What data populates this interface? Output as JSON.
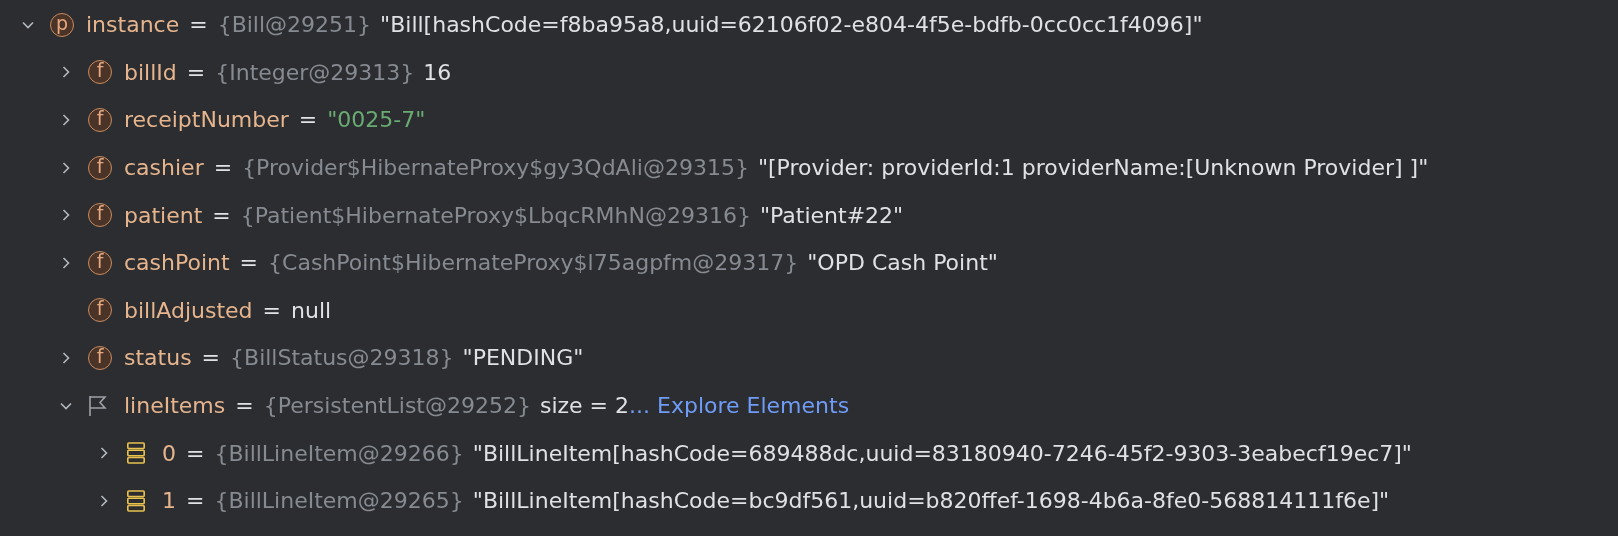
{
  "tree": [
    {
      "name": "instance",
      "icon": {
        "kind": "letter",
        "glyph": "p"
      },
      "expandable": true,
      "expanded": true,
      "eq": "=",
      "type": "{Bill@29251}",
      "value": "\"Bill[hashCode=f8ba95a8,uuid=62106f02-e804-4f5e-bdfb-0cc0cc1f4096]\"",
      "string": false,
      "children": [
        {
          "name": "billId",
          "icon": {
            "kind": "letter",
            "glyph": "f"
          },
          "expandable": true,
          "expanded": false,
          "eq": "=",
          "type": "{Integer@29313}",
          "value": "16",
          "string": false
        },
        {
          "name": "receiptNumber",
          "icon": {
            "kind": "letter",
            "glyph": "f"
          },
          "expandable": true,
          "expanded": false,
          "eq": "=",
          "value": "\"0025-7\"",
          "string": true
        },
        {
          "name": "cashier",
          "icon": {
            "kind": "letter",
            "glyph": "f"
          },
          "expandable": true,
          "expanded": false,
          "eq": "=",
          "type": "{Provider$HibernateProxy$gy3QdAli@29315}",
          "value": "\"[Provider: providerId:1 providerName:[Unknown Provider] ]\"",
          "string": false
        },
        {
          "name": "patient",
          "icon": {
            "kind": "letter",
            "glyph": "f"
          },
          "expandable": true,
          "expanded": false,
          "eq": "=",
          "type": "{Patient$HibernateProxy$LbqcRMhN@29316}",
          "value": "\"Patient#22\"",
          "string": false
        },
        {
          "name": "cashPoint",
          "icon": {
            "kind": "letter",
            "glyph": "f"
          },
          "expandable": true,
          "expanded": false,
          "eq": "=",
          "type": "{CashPoint$HibernateProxy$l75agpfm@29317}",
          "value": "\"OPD Cash Point\"",
          "string": false
        },
        {
          "name": "billAdjusted",
          "icon": {
            "kind": "letter",
            "glyph": "f"
          },
          "expandable": false,
          "eq": "=",
          "value": "null",
          "string": false
        },
        {
          "name": "status",
          "icon": {
            "kind": "letter",
            "glyph": "f"
          },
          "expandable": true,
          "expanded": false,
          "eq": "=",
          "type": "{BillStatus@29318}",
          "value": "\"PENDING\"",
          "string": false
        },
        {
          "name": "lineItems",
          "icon": {
            "kind": "flag"
          },
          "expandable": true,
          "expanded": true,
          "eq": "=",
          "type": "{PersistentList@29252}",
          "value": "size = 2",
          "string": false,
          "link": "... Explore Elements",
          "children": [
            {
              "name": "0",
              "icon": {
                "kind": "stack"
              },
              "expandable": true,
              "expanded": false,
              "eq": "=",
              "type": "{BillLineItem@29266}",
              "value": "\"BillLineItem[hashCode=689488dc,uuid=83180940-7246-45f2-9303-3eabecf19ec7]\"",
              "string": false
            },
            {
              "name": "1",
              "icon": {
                "kind": "stack"
              },
              "expandable": true,
              "expanded": false,
              "eq": "=",
              "type": "{BillLineItem@29265}",
              "value": "\"BillLineItem[hashCode=bc9df561,uuid=b820ffef-1698-4b6a-8fe0-568814111f6e]\"",
              "string": false
            }
          ]
        }
      ]
    }
  ]
}
